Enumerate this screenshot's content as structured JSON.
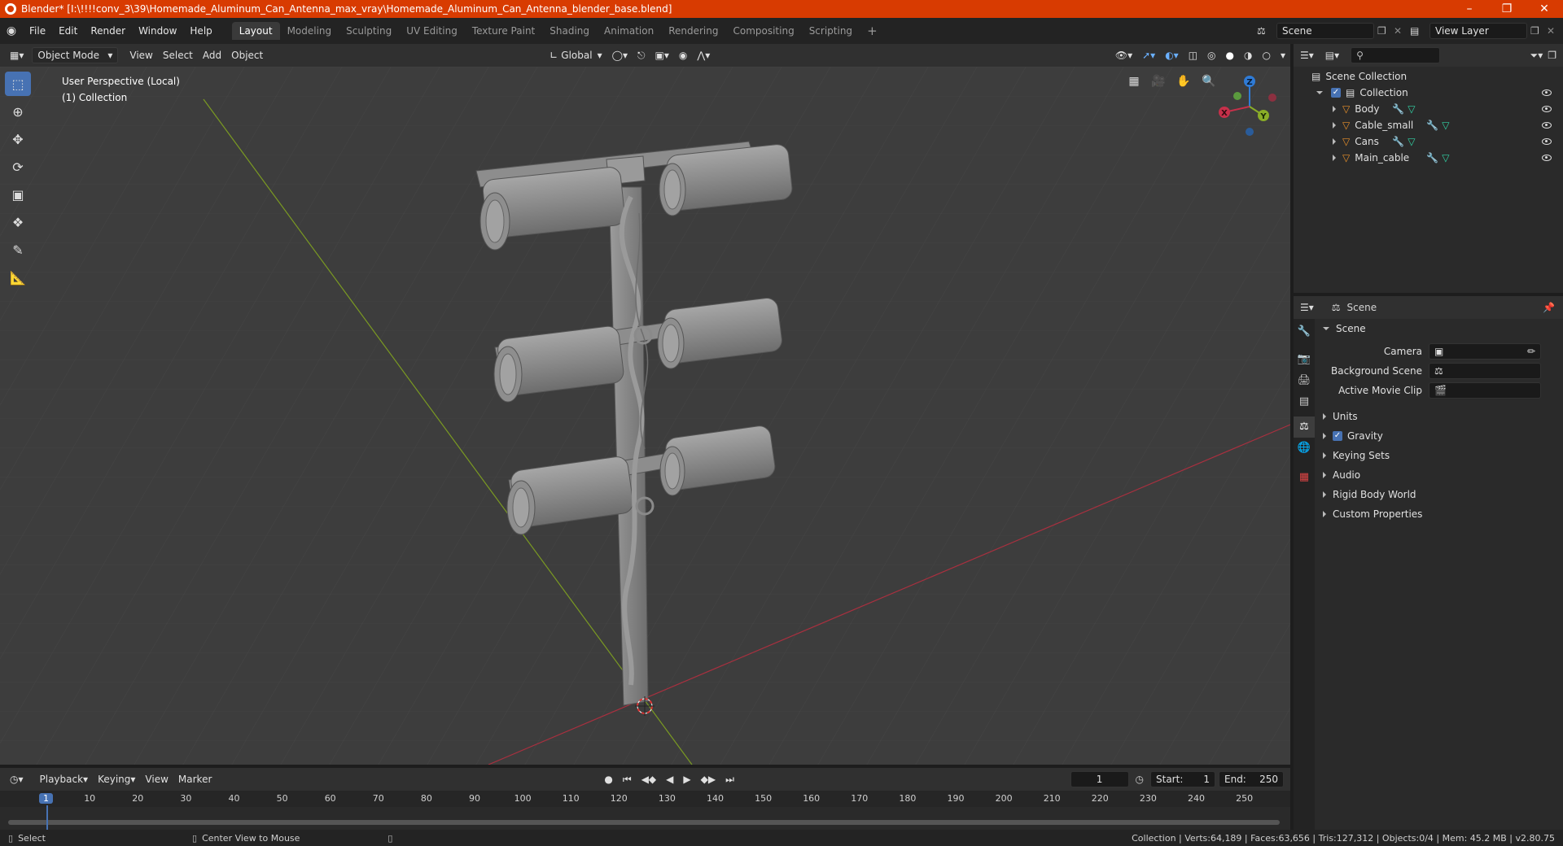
{
  "titlebar": {
    "title": "Blender* [I:\\!!!!conv_3\\39\\Homemade_Aluminum_Can_Antenna_max_vray\\Homemade_Aluminum_Can_Antenna_blender_base.blend]"
  },
  "menus": [
    "File",
    "Edit",
    "Render",
    "Window",
    "Help"
  ],
  "workspaces": [
    "Layout",
    "Modeling",
    "Sculpting",
    "UV Editing",
    "Texture Paint",
    "Shading",
    "Animation",
    "Rendering",
    "Compositing",
    "Scripting"
  ],
  "scene_field": "Scene",
  "view_layer_field": "View Layer",
  "viewport_header": {
    "mode": "Object Mode",
    "view": "View",
    "select": "Select",
    "add": "Add",
    "object": "Object",
    "transform": "Global"
  },
  "viewport_info": {
    "line1": "User Perspective (Local)",
    "line2": "(1) Collection"
  },
  "gizmo": {
    "x": "X",
    "y": "Y",
    "z": "Z"
  },
  "outliner": {
    "root": "Scene Collection",
    "collection": "Collection",
    "items": [
      "Body",
      "Cable_small",
      "Cans",
      "Main_cable"
    ]
  },
  "properties": {
    "header": "Scene",
    "section": "Scene",
    "camera_label": "Camera",
    "bg_scene_label": "Background Scene",
    "movie_clip_label": "Active Movie Clip",
    "panels": [
      "Units",
      "Gravity",
      "Keying Sets",
      "Audio",
      "Rigid Body World",
      "Custom Properties"
    ]
  },
  "timeline": {
    "playback": "Playback",
    "keying": "Keying",
    "view": "View",
    "marker": "Marker",
    "current_frame": "1",
    "start_label": "Start:",
    "start": "1",
    "end_label": "End:",
    "end": "250",
    "ticks": [
      "1",
      "10",
      "20",
      "30",
      "40",
      "50",
      "60",
      "70",
      "80",
      "90",
      "100",
      "110",
      "120",
      "130",
      "140",
      "150",
      "160",
      "170",
      "180",
      "190",
      "200",
      "210",
      "220",
      "230",
      "240",
      "250"
    ]
  },
  "status": {
    "select": "Select",
    "center": "Center View to Mouse",
    "stats": "Collection | Verts:64,189 | Faces:63,656 | Tris:127,312 | Objects:0/4 | Mem: 45.2 MB | v2.80.75"
  },
  "colors": {
    "accent": "#4772b3",
    "titlebar": "#d83b01",
    "x_axis": "#c6304a",
    "y_axis": "#8aad28",
    "z_axis": "#2f7bd6",
    "mesh_icon": "#e8902a",
    "modifier_icon": "#6ab0ff",
    "data_icon": "#32d4a6"
  }
}
